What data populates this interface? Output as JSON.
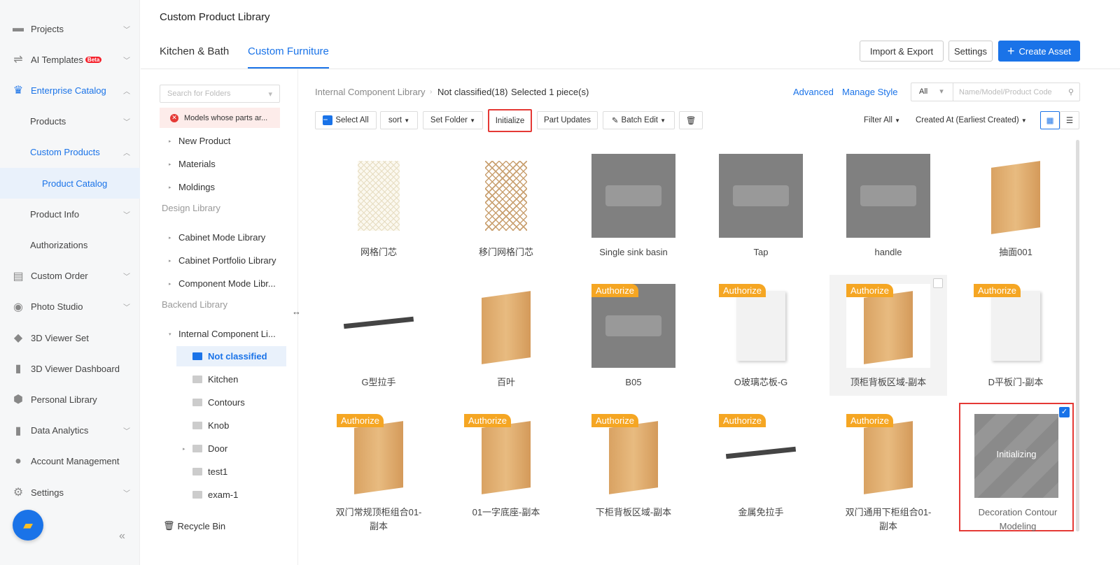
{
  "sidebar": {
    "items": [
      {
        "label": "Projects",
        "icon": "folder-icon"
      },
      {
        "label": "AI Templates",
        "badge": "Beta",
        "icon": "templates-icon"
      },
      {
        "label": "Enterprise Catalog",
        "icon": "crown-icon"
      },
      {
        "label": "Products"
      },
      {
        "label": "Custom Products"
      },
      {
        "label": "Product Catalog"
      },
      {
        "label": "Product Info"
      },
      {
        "label": "Authorizations"
      },
      {
        "label": "Custom Order",
        "icon": "clipboard-icon"
      },
      {
        "label": "Photo Studio",
        "icon": "camera-icon"
      },
      {
        "label": "3D Viewer Set",
        "icon": "shapes-icon"
      },
      {
        "label": "3D Viewer Dashboard",
        "icon": "bar-chart-icon"
      },
      {
        "label": "Personal Library",
        "icon": "cube-icon"
      },
      {
        "label": "Data Analytics",
        "icon": "analytics-icon"
      },
      {
        "label": "Account Management",
        "icon": "user-icon"
      },
      {
        "label": "Settings",
        "icon": "gear-icon"
      }
    ]
  },
  "header": {
    "title": "Custom Product Library",
    "tabs": [
      "Kitchen & Bath",
      "Custom Furniture"
    ],
    "import_export": "Import & Export",
    "settings": "Settings",
    "create": "Create Asset"
  },
  "folders": {
    "search_placeholder": "Search for Folders",
    "error": "Models whose parts ar...",
    "items": [
      "New Product",
      "Materials",
      "Moldings"
    ],
    "design_library": "Design Library",
    "design_items": [
      "Cabinet Mode Library",
      "Cabinet Portfolio Library",
      "Component Mode Libr..."
    ],
    "backend_library": "Backend Library",
    "internal": "Internal Component Li...",
    "not_classified": "Not classified",
    "sub": [
      "Kitchen",
      "Contours",
      "Knob",
      "Door",
      "test1",
      "exam-1"
    ],
    "recycle": "Recycle Bin"
  },
  "toolbar": {
    "crumb_parent": "Internal Component Library",
    "crumb_current": "Not classified(18)",
    "selected": "Selected 1 piece(s)",
    "advanced": "Advanced",
    "manage_style": "Manage Style",
    "scope": "All",
    "search_placeholder": "Name/Model/Product Code",
    "select_all": "Select All",
    "sort": "sort",
    "set_folder": "Set Folder",
    "initialize": "Initialize",
    "part_updates": "Part Updates",
    "batch_edit": "Batch Edit",
    "filter": "Filter All",
    "order": "Created At (Earliest Created)"
  },
  "products": [
    {
      "name": "网格门芯",
      "thumb": "grid"
    },
    {
      "name": "移门网格门芯",
      "thumb": "grid2"
    },
    {
      "name": "Single sink basin",
      "thumb": "gray"
    },
    {
      "name": "Tap",
      "thumb": "gray"
    },
    {
      "name": "handle",
      "thumb": "gray"
    },
    {
      "name": "抽面001",
      "thumb": "wood"
    },
    {
      "name": "G型拉手",
      "thumb": "bar"
    },
    {
      "name": "百叶",
      "thumb": "wood"
    },
    {
      "name": "B05",
      "thumb": "gray",
      "badge": "Authorize"
    },
    {
      "name": "O玻璃芯板-G",
      "thumb": "white",
      "badge": "Authorize"
    },
    {
      "name": "顶柜背板区域-副本",
      "thumb": "wood",
      "badge": "Authorize"
    },
    {
      "name": "D平板门-副本",
      "thumb": "white",
      "badge": "Authorize"
    },
    {
      "name": "双门常规顶柜组合01-副本",
      "thumb": "wood",
      "badge": "Authorize"
    },
    {
      "name": "01一字底座-副本",
      "thumb": "wood",
      "badge": "Authorize"
    },
    {
      "name": "下柜背板区域-副本",
      "thumb": "wood",
      "badge": "Authorize"
    },
    {
      "name": "金属免拉手",
      "thumb": "bar",
      "badge": "Authorize"
    },
    {
      "name": "双门通用下柜组合01-副本",
      "thumb": "wood",
      "badge": "Authorize"
    },
    {
      "name": "Decoration Contour Modeling",
      "thumb": "init",
      "status": "Initializing",
      "selected": true
    }
  ]
}
